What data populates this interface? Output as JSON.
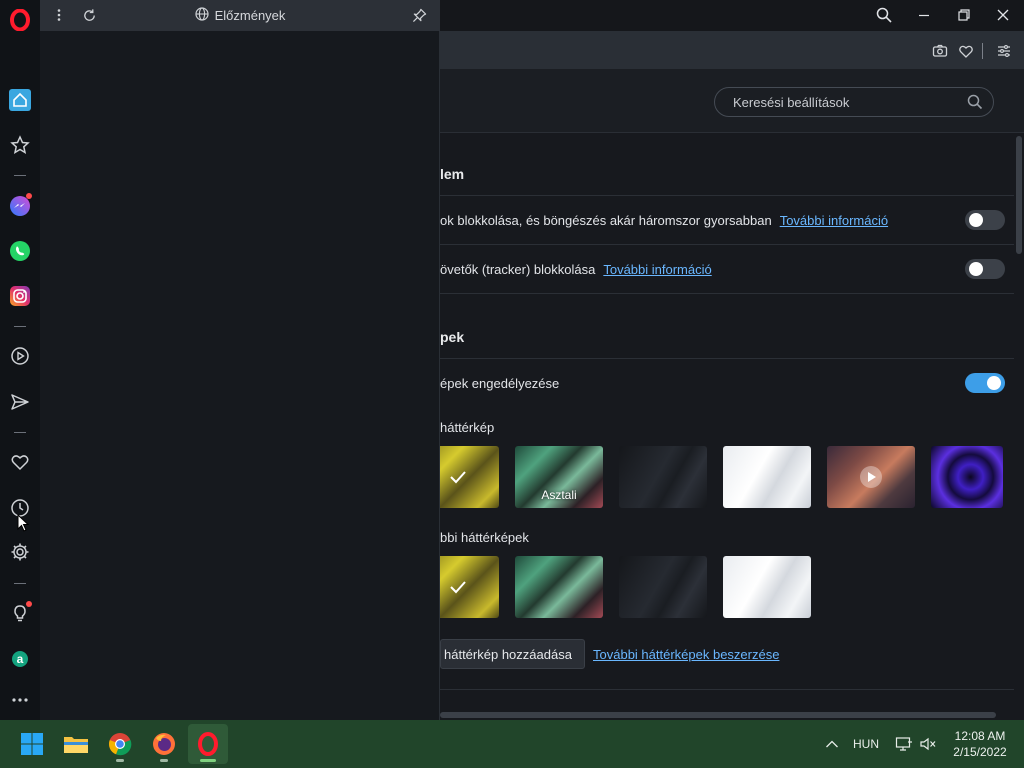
{
  "history_panel": {
    "title": "Előzmények",
    "icons": [
      "kebab-menu-icon",
      "reload-icon",
      "globe-icon",
      "pin-icon"
    ]
  },
  "sidebar": {
    "items": [
      {
        "name": "opera-logo-icon"
      },
      {
        "name": "home-icon"
      },
      {
        "name": "star-icon"
      },
      {
        "name": "messenger-icon",
        "badge": true
      },
      {
        "name": "whatsapp-icon"
      },
      {
        "name": "instagram-icon"
      },
      {
        "name": "player-icon"
      },
      {
        "name": "send-icon"
      },
      {
        "name": "heart-icon"
      },
      {
        "name": "history-icon"
      },
      {
        "name": "settings-icon"
      },
      {
        "name": "lightbulb-icon",
        "badge": true
      },
      {
        "name": "aria-icon"
      },
      {
        "name": "more-icon"
      }
    ]
  },
  "settings": {
    "search_placeholder": "Keresési beállítások",
    "section_adblock_title": "lem",
    "adblock_row": "ok blokkolása, és böngészés akár háromszor gyorsabban",
    "tracker_row": "övetők (tracker) blokkolása",
    "more_info_link": "További információ",
    "section_wallpaper_title": "pek",
    "wallpaper_enable_row": "épek engedélyezése",
    "wallpaper_label": "háttérkép",
    "other_wallpapers_label": "bbi háttérképek",
    "desktop_caption": "Asztali",
    "add_wallpaper_button": "háttérkép hozzáadása",
    "more_wallpapers_link": "További háttérképek beszerzése",
    "toggles": {
      "adblock": false,
      "tracker": false,
      "wallpapers": true
    }
  },
  "taskbar": {
    "language": "HUN",
    "time": "12:08 AM",
    "date": "2/15/2022",
    "apps": [
      "start-icon",
      "file-explorer-icon",
      "chrome-icon",
      "firefox-icon",
      "opera-icon"
    ]
  },
  "colors": {
    "accent": "#3d9ee8",
    "link": "#6ab7ff",
    "opera_red": "#ff1b2d",
    "taskbar": "#21452a"
  }
}
